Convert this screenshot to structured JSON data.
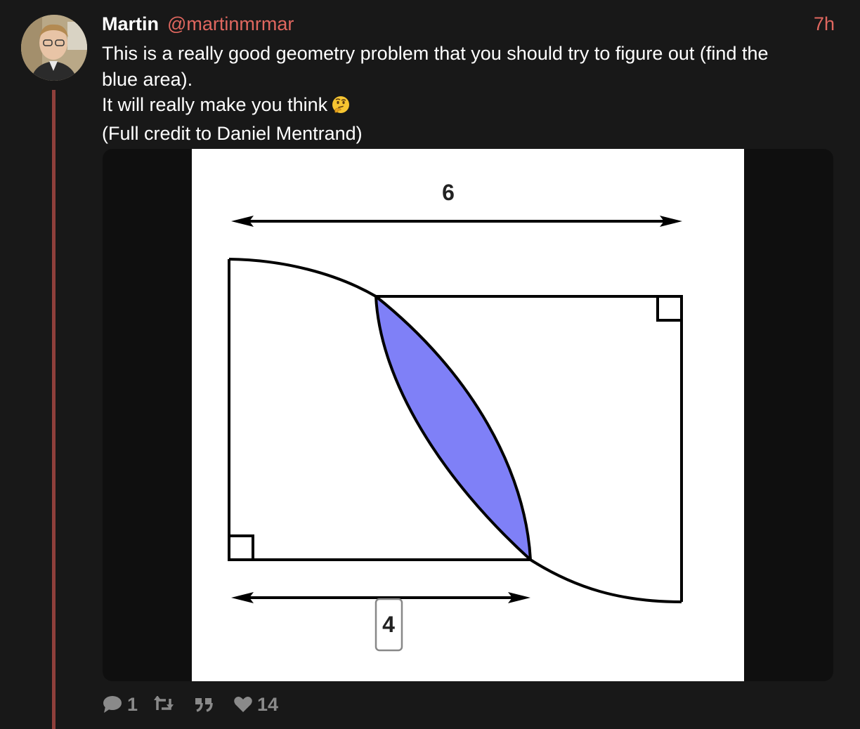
{
  "post": {
    "author": {
      "display_name": "Martin",
      "handle": "@martinmrmar"
    },
    "time": "7h",
    "text_lines": [
      "This is a really good geometry problem that you should try to figure out (find the",
      "blue area).",
      "It will really make you think",
      "(Full credit to Daniel Mentrand)"
    ],
    "emoji": "thinking-face",
    "figure": {
      "top_label": "6",
      "bottom_label": "4",
      "fill_color": "#7f80f7"
    },
    "actions": {
      "reply_count": "1",
      "repost_count": "",
      "quote_count": "",
      "like_count": "14"
    }
  },
  "colors": {
    "background": "#181818",
    "handle": "#e0675f",
    "thread_line": "#8e3f3b",
    "muted": "#8a8a8a"
  }
}
